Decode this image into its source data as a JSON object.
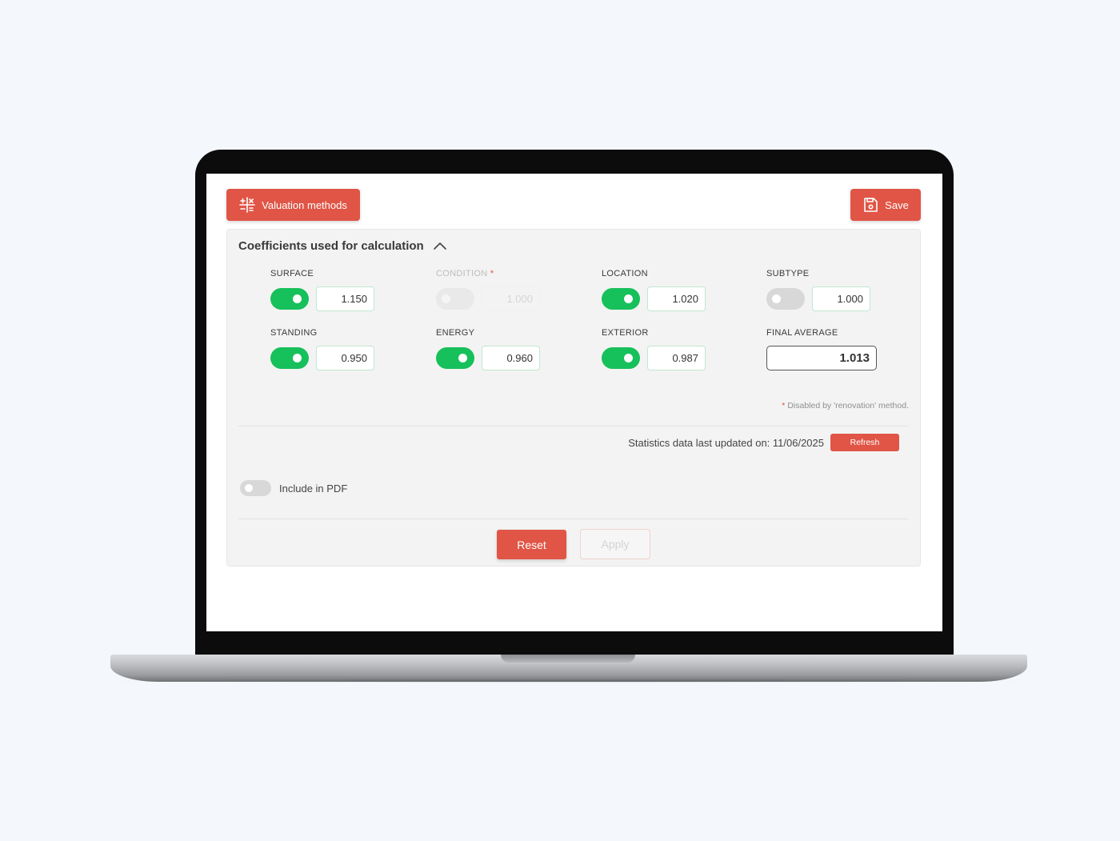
{
  "toolbar": {
    "valuation_label": "Valuation methods",
    "valuation_icon": "calculator-icon",
    "save_label": "Save",
    "save_icon": "floppy-disk-icon"
  },
  "panel": {
    "title": "Coefficients used for calculation",
    "collapse_icon": "chevron-up-icon",
    "coefficients": [
      {
        "label": "SURFACE",
        "value": "1.150",
        "enabled": true
      },
      {
        "label": "CONDITION",
        "required_mark": "*",
        "value": "1.000",
        "enabled": false,
        "disabled": true
      },
      {
        "label": "LOCATION",
        "value": "1.020",
        "enabled": true
      },
      {
        "label": "SUBTYPE",
        "value": "1.000",
        "enabled": false
      },
      {
        "label": "STANDING",
        "value": "0.950",
        "enabled": true
      },
      {
        "label": "ENERGY",
        "value": "0.960",
        "enabled": true
      },
      {
        "label": "EXTERIOR",
        "value": "0.987",
        "enabled": true
      }
    ],
    "final_average": {
      "label": "FINAL AVERAGE",
      "value": "1.013"
    },
    "note": {
      "mark": "*",
      "text": "Disabled by 'renovation' method."
    },
    "stats_text": "Statistics data last updated on: 11/06/2025",
    "refresh_label": "Refresh",
    "pdf_label": "Include in PDF",
    "pdf_enabled": false,
    "reset_label": "Reset",
    "apply_label": "Apply"
  },
  "colors": {
    "accent": "#e05546",
    "toggle_on": "#16c05a",
    "background": "#f4f7fc"
  }
}
